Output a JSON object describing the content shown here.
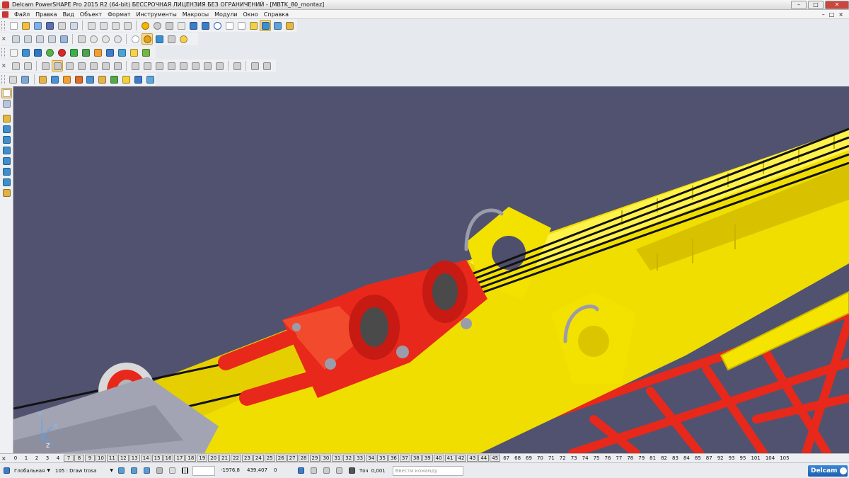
{
  "window": {
    "title": "Delcam PowerSHAPE Pro 2015 R2 (64-bit) БЕССРОЧНАЯ ЛИЦЕНЗИЯ БЕЗ ОГРАНИЧЕНИЙ - [MBTK_80_montaz]",
    "controls": [
      "–",
      "□",
      "✕"
    ]
  },
  "menu": {
    "items": [
      "Файл",
      "Правка",
      "Вид",
      "Объект",
      "Формат",
      "Инструменты",
      "Макросы",
      "Модули",
      "Окно",
      "Справка"
    ],
    "mdi_controls": [
      "–",
      "□",
      "×"
    ]
  },
  "toolbars": {
    "row1_icons": [
      "new-file-icon",
      "open-file-icon",
      "open-model-icon",
      "save-icon",
      "print-icon",
      "print-preview-icon",
      "cut-icon",
      "copy-icon",
      "paste-icon",
      "delete-icon",
      "undo-icon",
      "redo-icon",
      "wizard-icon",
      "select-icon",
      "line-icon",
      "curve-icon",
      "circle-icon",
      "arc-icon",
      "text-icon",
      "dimension-icon",
      "surface-icon",
      "solid-icon",
      "tools-icon"
    ],
    "row2_icons": [
      "view-iso-icon",
      "view-top-icon",
      "view-front-icon",
      "view-right-icon",
      "view-rotate-icon",
      "pan-icon",
      "zoom-icon",
      "zoom-fit-icon",
      "zoom-window-icon",
      "globe-icon",
      "shaded-icon",
      "wireframe-icon",
      "light-icon",
      "lamp-icon"
    ],
    "row3_icons": [
      "layer-icon",
      "box-icon",
      "cylinder-icon",
      "sphere-icon",
      "cone-icon",
      "torus-icon",
      "extrude-icon",
      "revolve-icon",
      "blend-icon",
      "boolean-icon",
      "shell-icon",
      "fillet-icon"
    ],
    "row4_icons": [
      "feature-1-icon",
      "feature-2-icon",
      "feature-3-icon",
      "feature-4-icon",
      "feature-5-icon",
      "feature-6-icon",
      "feature-7-icon",
      "feature-8-icon",
      "feature-9-icon",
      "feature-10-icon",
      "feature-11-icon",
      "feature-12-icon",
      "feature-13-icon",
      "feature-14-icon",
      "feature-15-icon",
      "feature-16-icon",
      "feature-17-icon",
      "feature-18-icon",
      "feature-19-icon",
      "feature-20-icon"
    ],
    "row5_icons": [
      "assembly-icon",
      "component-icon",
      "insert-icon",
      "mate-icon",
      "pipe-icon",
      "wire-icon",
      "electrode-icon",
      "mold-icon",
      "check-icon",
      "measure-icon",
      "analysis-icon",
      "pyramid-icon"
    ],
    "left_icons": [
      "pointer-icon",
      "select-filter-icon",
      "solid-feature-icon",
      "cube-icon",
      "cube-edit-icon",
      "cube-cut-icon",
      "cube-shell-icon",
      "cube-fillet-icon",
      "cube-rotate-icon",
      "cube-tool-icon"
    ]
  },
  "layers": {
    "labels": [
      "0",
      "1",
      "2",
      "3",
      "4",
      "7",
      "8",
      "9",
      "10",
      "11",
      "12",
      "13",
      "14",
      "15",
      "16",
      "17",
      "18",
      "19",
      "20",
      "21",
      "22",
      "23",
      "24",
      "25",
      "26",
      "27",
      "28",
      "29",
      "30",
      "31",
      "32",
      "33",
      "34",
      "35",
      "36",
      "37",
      "38",
      "39",
      "40",
      "41",
      "42",
      "43",
      "44",
      "45",
      "67",
      "68",
      "69",
      "70",
      "71",
      "72",
      "73",
      "74",
      "75",
      "76",
      "77",
      "78",
      "79",
      "81",
      "82",
      "83",
      "84",
      "85",
      "87",
      "92",
      "93",
      "95",
      "101",
      "104",
      "105"
    ],
    "empty": [
      "7",
      "8",
      "9",
      "10",
      "11",
      "12",
      "13",
      "14",
      "15",
      "16",
      "17",
      "18",
      "19",
      "20",
      "21",
      "22",
      "23",
      "24",
      "25",
      "26",
      "27",
      "28",
      "29",
      "30",
      "31",
      "32",
      "33",
      "34",
      "35",
      "36",
      "37",
      "38",
      "39",
      "40",
      "41",
      "42",
      "43",
      "44",
      "45"
    ]
  },
  "status": {
    "workplane": "Глобальная",
    "level": "105 : Draw trosa",
    "coord_x": "-1976,8",
    "coord_y": "439,407",
    "coord_z": "0",
    "tolerance_label": "Точ",
    "tolerance": "0,001",
    "command_placeholder": "Ввести команду",
    "brand": "Delcam"
  },
  "viewport": {
    "background": "#515270",
    "axis_labels": [
      "Y",
      "X",
      "Z"
    ]
  },
  "colors": {
    "boom_yellow": "#f2e000",
    "clamp_red": "#e8281b",
    "cable_black": "#121212",
    "grey_bracket": "#9b9caa"
  }
}
